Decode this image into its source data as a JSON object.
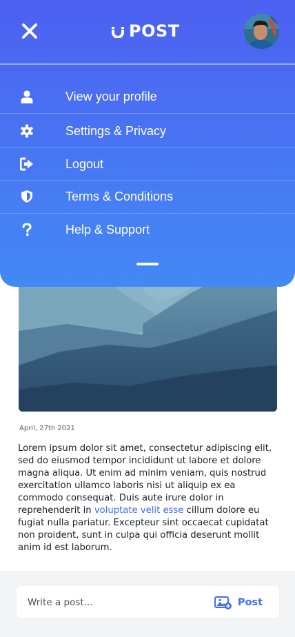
{
  "header": {
    "logo_text": "POST"
  },
  "menu": {
    "items": [
      {
        "label": "View your profile",
        "icon": "user-icon"
      },
      {
        "label": "Settings & Privacy",
        "icon": "gear-icon"
      },
      {
        "label": "Logout",
        "icon": "logout-icon"
      },
      {
        "label": "Terms & Conditions",
        "icon": "shield-icon"
      },
      {
        "label": "Help & Support",
        "icon": "question-icon"
      }
    ]
  },
  "post": {
    "date": "April, 27th 2021",
    "body_before_link": "Lorem ipsum dolor sit amet, consectetur adipiscing elit, sed do eiusmod tempor incididunt ut labore et dolore magna aliqua. Ut enim ad minim veniam, quis nostrud exercitation ullamco laboris nisi ut aliquip ex ea commodo consequat. Duis aute irure dolor in reprehenderit in ",
    "body_link": "voluptate velit esse",
    "body_after_link": " cillum dolore eu fugiat nulla pariatur. Excepteur sint occaecat cupidatat non proident, sunt in culpa qui officia deserunt mollit anim id est laborum."
  },
  "composer": {
    "placeholder": "Write a post...",
    "post_label": "Post"
  },
  "colors": {
    "menu_gradient_top": "#4d60f1",
    "menu_gradient_bottom": "#4388f5",
    "accent": "#3e6df2",
    "text": "#1b1f26"
  }
}
